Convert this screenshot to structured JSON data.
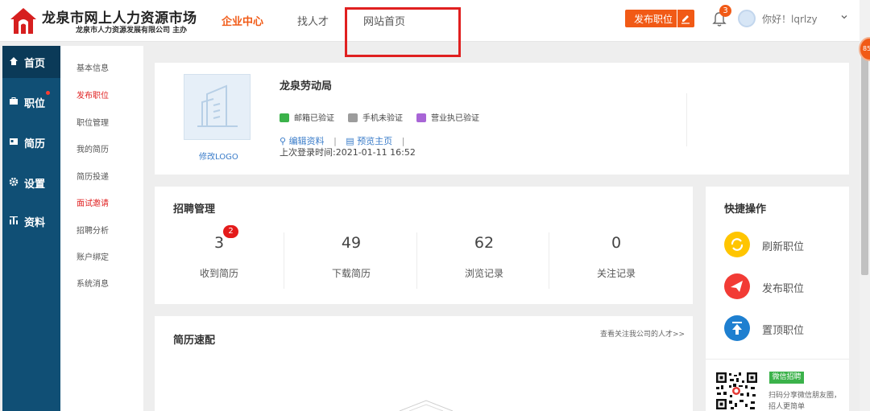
{
  "header": {
    "logo_title": "龙泉市网上人力资源市场",
    "logo_subtitle": "龙泉市人力资源发展有限公司 主办",
    "nav": {
      "enterprise": "企业中心",
      "find_talent": "找人才",
      "site_home": "网站首页"
    },
    "post_job_button": "发布职位",
    "notification_count": "3",
    "greeting": "你好！lqrlzy"
  },
  "float_badge": "85",
  "left_nav": [
    {
      "label": "首页",
      "icon": "home-icon"
    },
    {
      "label": "职位",
      "icon": "briefcase-icon"
    },
    {
      "label": "简历",
      "icon": "id-card-icon"
    },
    {
      "label": "设置",
      "icon": "gear-icon"
    },
    {
      "label": "资料",
      "icon": "chart-icon"
    }
  ],
  "sub_menu": [
    "基本信息",
    "发布职位",
    "职位管理",
    "我的简历",
    "简历投递",
    "面试邀请",
    "招聘分析",
    "账户绑定",
    "系统消息"
  ],
  "profile": {
    "company_name": "龙泉劳动局",
    "change_logo": "修改LOGO",
    "verify": {
      "email": "邮箱已验证",
      "phone": "手机未验证",
      "license": "营业执已验证"
    },
    "edit_link": "编辑资料",
    "preview_link": "预览主页",
    "last_login": "上次登录时间:2021-01-11 16:52"
  },
  "recruit": {
    "title": "招聘管理",
    "stats": [
      {
        "value": "3",
        "label": "收到简历"
      },
      {
        "value": "49",
        "label": "下载简历"
      },
      {
        "value": "62",
        "label": "浏览记录"
      },
      {
        "value": "0",
        "label": "关注记录"
      }
    ],
    "new_badge": "2"
  },
  "quick": {
    "title": "快捷操作",
    "actions": [
      "刷新职位",
      "发布职位",
      "置顶职位"
    ],
    "wechat_tag": "微信招聘",
    "wechat_text_1": "扫码分享微信朋友圈，",
    "wechat_text_2": "招人更简单"
  },
  "match": {
    "title": "简历速配",
    "link": "查看关注我公司的人才>>"
  },
  "colors": {
    "accent": "#f15a16",
    "nav_bg": "#104f75",
    "link": "#3a7cc9",
    "highlight": "#e02020"
  }
}
